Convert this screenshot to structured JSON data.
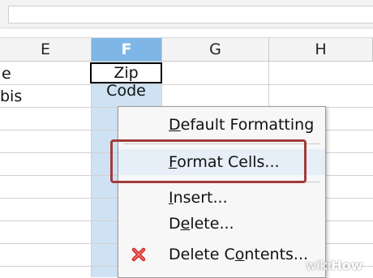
{
  "columns": [
    {
      "label": "E",
      "selected": false
    },
    {
      "label": "F",
      "selected": true
    },
    {
      "label": "G",
      "selected": false
    },
    {
      "label": "H",
      "selected": false
    }
  ],
  "cells": {
    "e_row1": "e",
    "e_row2": "bis",
    "f_row1": "Zip Code"
  },
  "context_menu": {
    "items": [
      {
        "pre": "",
        "accel": "D",
        "post": "efault Formatting"
      },
      {
        "pre": "",
        "accel": "F",
        "post": "ormat Cells..."
      },
      {
        "pre": "",
        "accel": "I",
        "post": "nsert..."
      },
      {
        "pre": "D",
        "accel": "e",
        "post": "lete..."
      },
      {
        "pre": "Delete C",
        "accel": "o",
        "post": "ntents..."
      }
    ],
    "delete_contents_icon": "red-x-icon"
  },
  "watermark": {
    "prefix": "wiki",
    "suffix": "How"
  },
  "colors": {
    "selected_column_header": "#7fb6e8",
    "selected_column_fill": "#cfe2f4",
    "highlight_box": "#a23a3a",
    "delete_icon": "#d42a2a"
  }
}
